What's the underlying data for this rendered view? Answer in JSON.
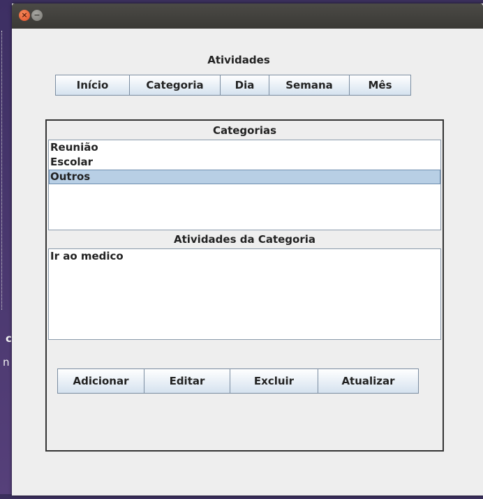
{
  "window": {
    "close_glyph": "×",
    "minimize_glyph": "−"
  },
  "header": {
    "title": "Atividades"
  },
  "nav": {
    "inicio": "Início",
    "categoria": "Categoria",
    "dia": "Dia",
    "semana": "Semana",
    "mes": "Mês"
  },
  "categories": {
    "title": "Categorias",
    "items": [
      "Reunião",
      "Escolar",
      "Outros"
    ],
    "selected_index": 2
  },
  "activities": {
    "title": "Atividades da Categoria",
    "items": [
      "Ir ao medico"
    ]
  },
  "actions": {
    "adicionar": "Adicionar",
    "editar": "Editar",
    "excluir": "Excluir",
    "atualizar": "Atualizar"
  },
  "desktop": {
    "fragment_1": "c",
    "fragment_2": "n"
  },
  "colors": {
    "button_gradient_bottom": "#d5e2ef",
    "selection": "#b8cfe5",
    "titlebar": "#3a3935",
    "close_button": "#e0502a"
  }
}
